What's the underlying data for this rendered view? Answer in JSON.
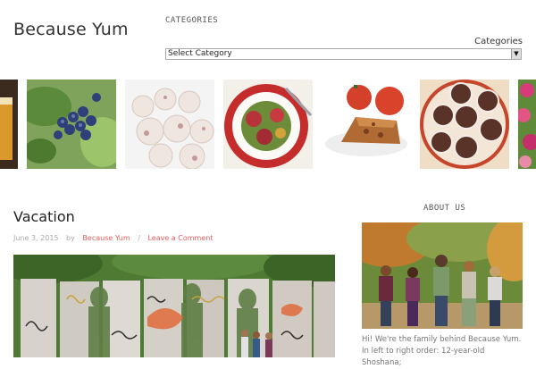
{
  "header": {
    "site_title": "Because Yum"
  },
  "categories": {
    "heading": "CATEGORIES",
    "label": "Categories",
    "selected": "Select Category"
  },
  "carousel": {
    "items": [
      "drink",
      "blueberries",
      "snowball cookies",
      "salad plate",
      "tomato crumble",
      "chocolate cupcakes",
      "flowers"
    ]
  },
  "post": {
    "title": "Vacation",
    "date": "June 3, 2015",
    "by": "by",
    "author": "Because Yum",
    "separator": "/",
    "comment_link": "Leave a Comment"
  },
  "sidebar": {
    "about_heading": "ABOUT US",
    "about_text": "Hi! We're the family behind Because Yum. In left to right order: 12-year-old Shoshana;"
  },
  "colors": {
    "accent": "#e25d5d",
    "meta": "#aaaaaa"
  }
}
